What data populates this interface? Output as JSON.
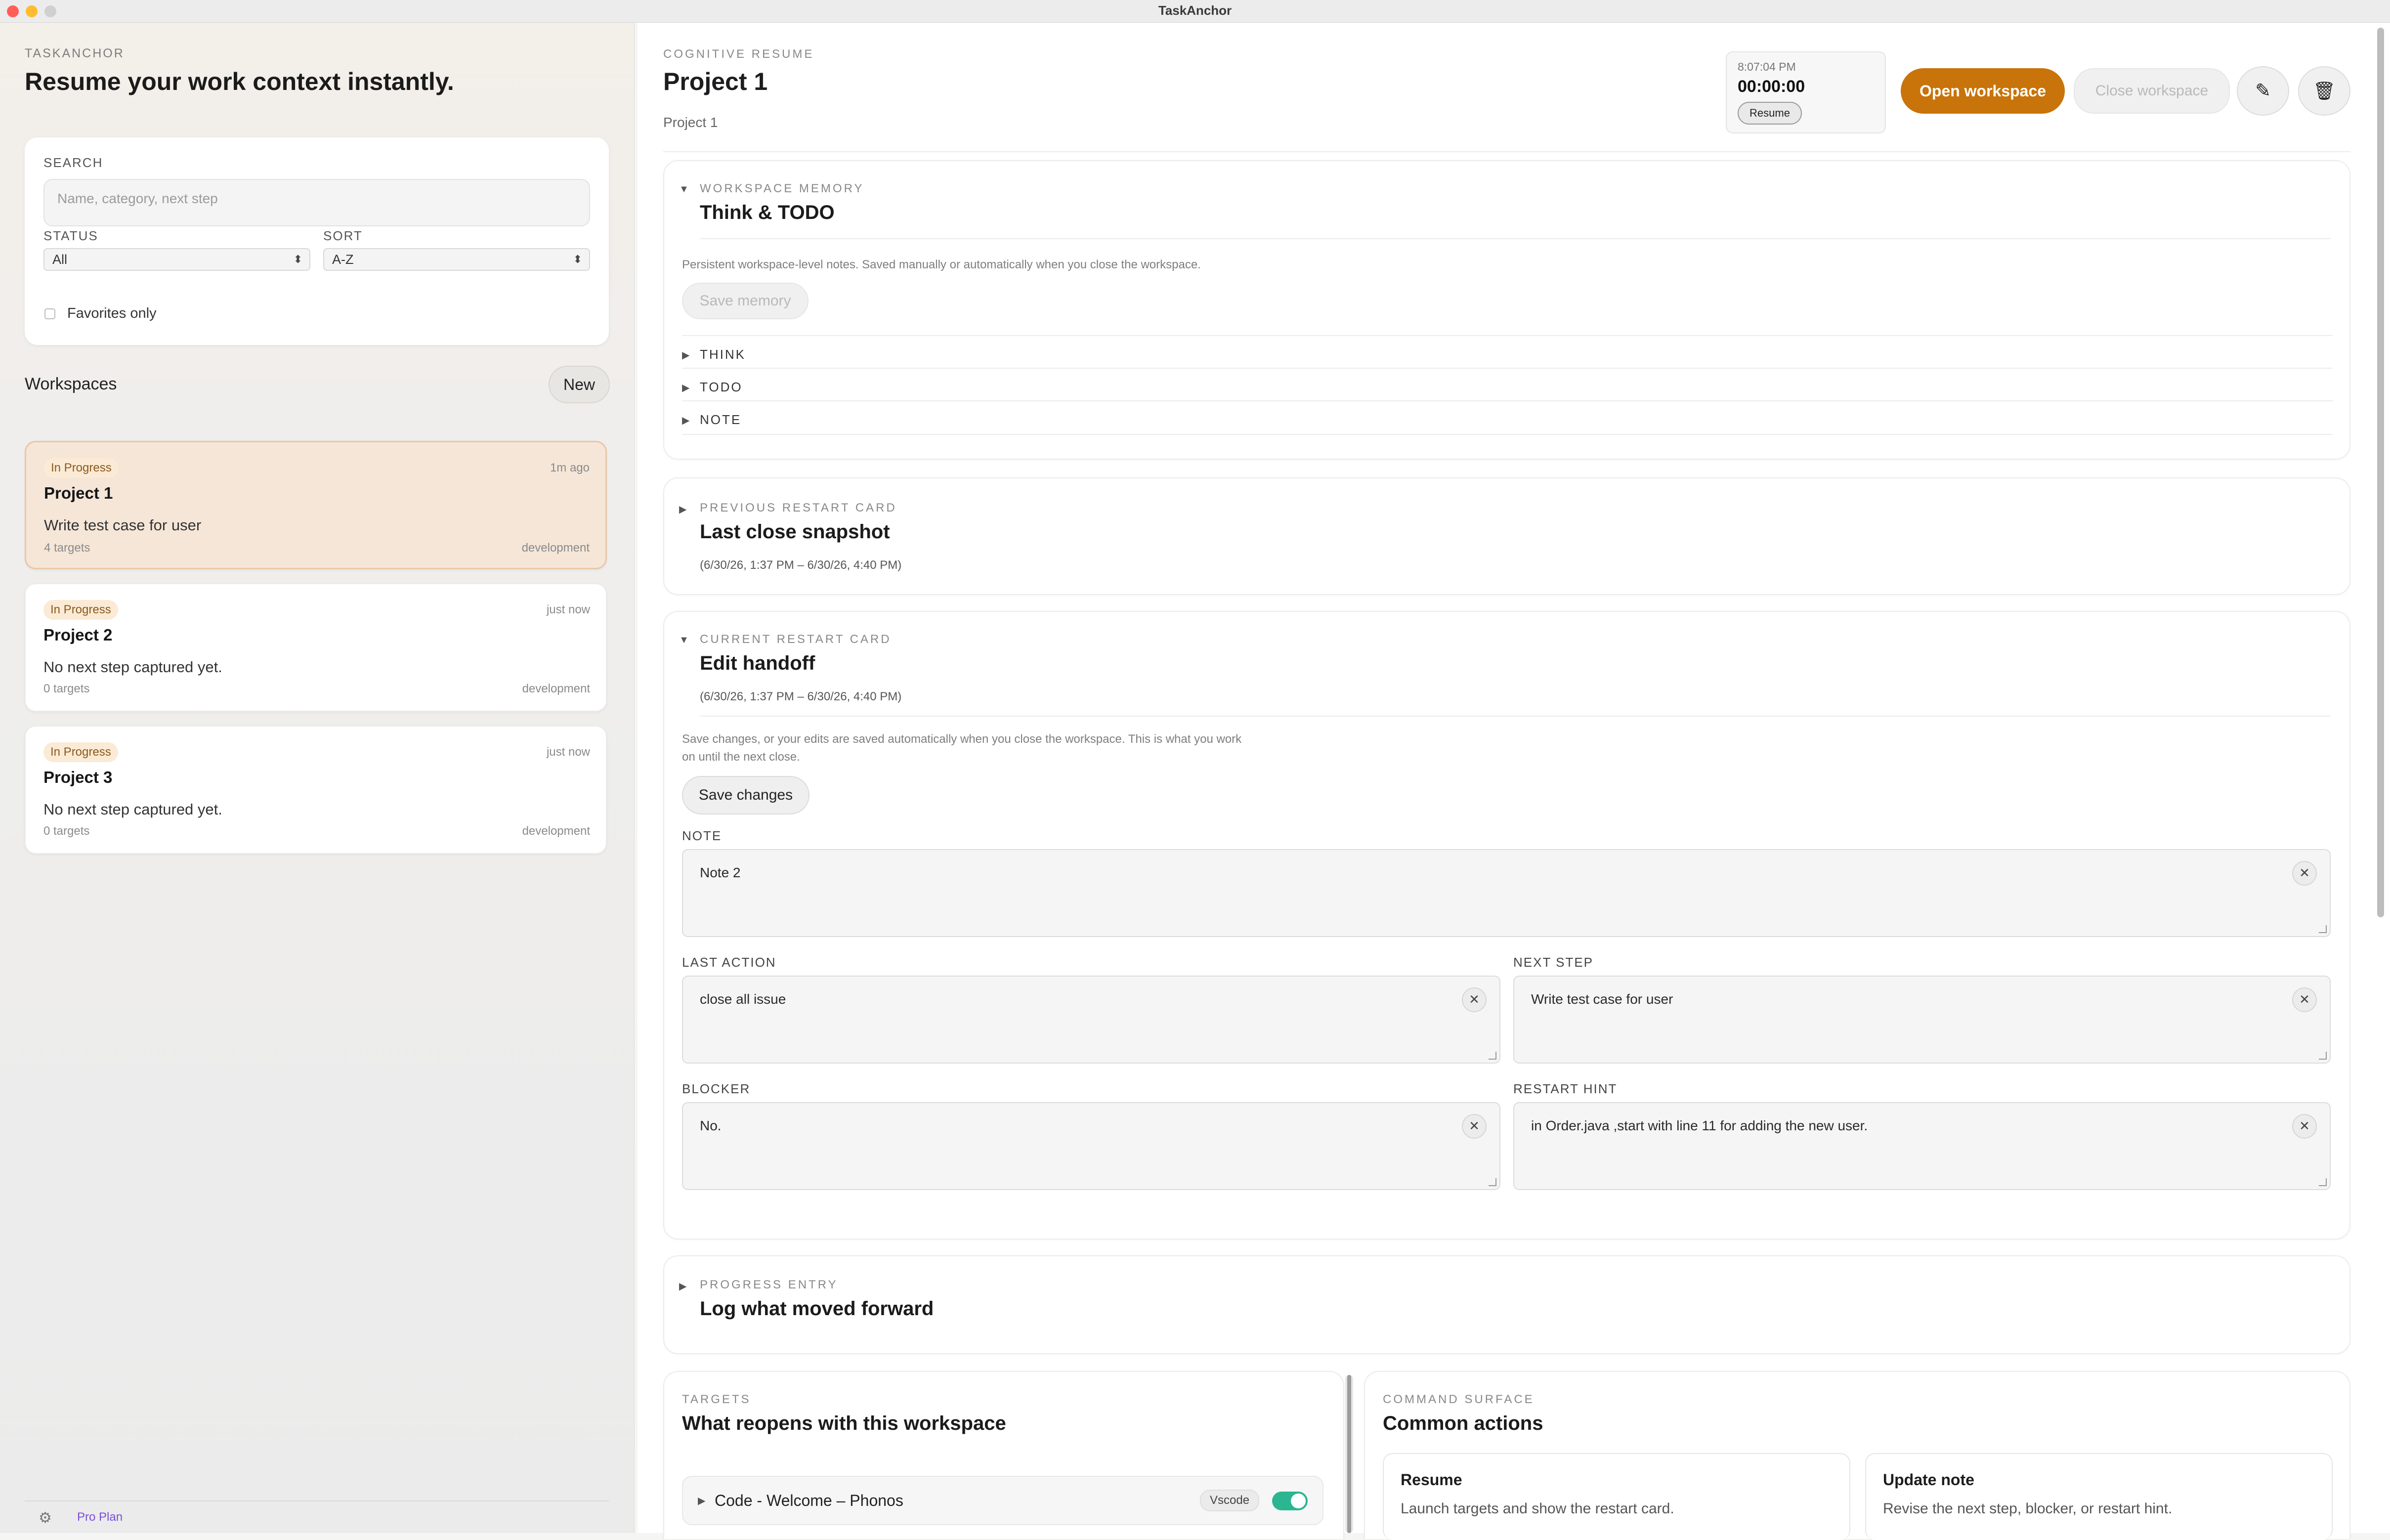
{
  "window": {
    "title": "TaskAnchor"
  },
  "sidebar": {
    "eyebrow": "TASKANCHOR",
    "headline": "Resume your work context instantly.",
    "search": {
      "label": "SEARCH",
      "placeholder": "Name, category, next step"
    },
    "status": {
      "label": "STATUS",
      "value": "All"
    },
    "sort": {
      "label": "SORT",
      "value": "A-Z"
    },
    "favorites_label": "Favorites only",
    "workspaces_label": "Workspaces",
    "new_button": "New",
    "workspaces": [
      {
        "badge": "In Progress",
        "time": "1m ago",
        "title": "Project 1",
        "next_step": "Write test case for user",
        "targets": "4 targets",
        "category": "development"
      },
      {
        "badge": "In Progress",
        "time": "just now",
        "title": "Project 2",
        "next_step": "No next step captured yet.",
        "targets": "0 targets",
        "category": "development"
      },
      {
        "badge": "In Progress",
        "time": "just now",
        "title": "Project 3",
        "next_step": "No next step captured yet.",
        "targets": "0 targets",
        "category": "development"
      }
    ],
    "footer": {
      "plan": "Pro Plan"
    }
  },
  "header": {
    "eyebrow": "COGNITIVE RESUME",
    "title": "Project 1",
    "subtitle": "Project 1",
    "timer": {
      "clock": "8:07:04 PM",
      "elapsed": "00:00:00",
      "resume": "Resume"
    },
    "open_workspace": "Open workspace",
    "close_workspace": "Close workspace"
  },
  "memory": {
    "eyebrow": "WORKSPACE MEMORY",
    "title": "Think & TODO",
    "description": "Persistent workspace-level notes. Saved manually or automatically when you close the workspace.",
    "save_button": "Save memory",
    "rows": [
      "THINK",
      "TODO",
      "NOTE"
    ]
  },
  "previous_card": {
    "eyebrow": "PREVIOUS RESTART CARD",
    "title": "Last close snapshot",
    "range": "(6/30/26, 1:37 PM – 6/30/26, 4:40 PM)"
  },
  "current_card": {
    "eyebrow": "CURRENT RESTART CARD",
    "title": "Edit handoff",
    "range": "(6/30/26, 1:37 PM – 6/30/26, 4:40 PM)",
    "description_line1": "Save changes, or your edits are saved automatically when you close the workspace. This is what you work",
    "description_line2": "on until the next close.",
    "save_button": "Save changes",
    "note": {
      "label": "NOTE",
      "value": "Note 2"
    },
    "last_action": {
      "label": "LAST ACTION",
      "value": "close all issue"
    },
    "next_step": {
      "label": "NEXT STEP",
      "value": "Write test case for user"
    },
    "blocker": {
      "label": "BLOCKER",
      "value": "No."
    },
    "restart_hint": {
      "label": "RESTART HINT",
      "value": "in Order.java ,start with  line 11 for adding the new user."
    }
  },
  "progress_entry": {
    "eyebrow": "PROGRESS ENTRY",
    "title": "Log what moved forward"
  },
  "targets": {
    "eyebrow": "TARGETS",
    "title": "What reopens with this workspace",
    "items": [
      {
        "name": "Code - Welcome – Phonos",
        "app": "Vscode",
        "enabled": true
      }
    ]
  },
  "command_surface": {
    "eyebrow": "COMMAND SURFACE",
    "title": "Common actions",
    "actions": [
      {
        "title": "Resume",
        "desc": "Launch targets and show the restart card."
      },
      {
        "title": "Update note",
        "desc": "Revise the next step, blocker, or restart hint."
      }
    ]
  },
  "colors": {
    "accent": "#c8740a",
    "toggle": "#2bb591",
    "selected_card": "#f5e6d8"
  }
}
